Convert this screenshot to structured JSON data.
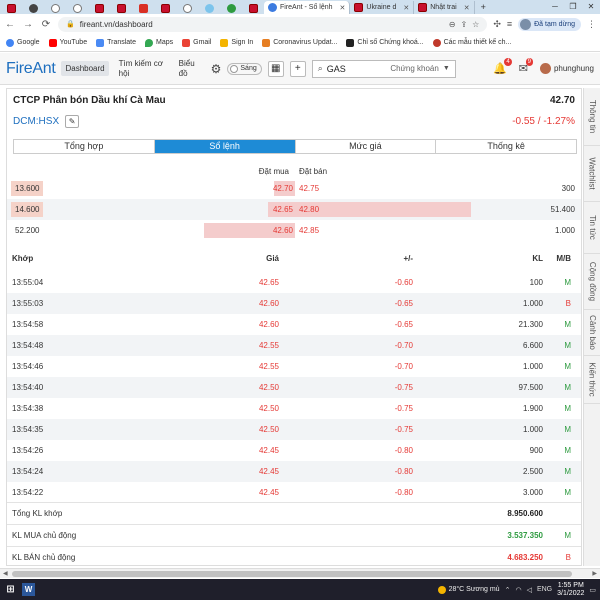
{
  "browser": {
    "tabs": [
      {
        "title": "FireAnt - Sổ lệnh",
        "active": true
      },
      {
        "title": "Ukraine d",
        "active": false
      },
      {
        "title": "Nhật trai",
        "active": false
      }
    ],
    "url": "fireant.vn/dashboard",
    "profile_label": "Đã tạm dừng",
    "bookmarks": [
      "Google",
      "YouTube",
      "Translate",
      "Maps",
      "Gmail",
      "Sign In",
      "Coronavirus Updat...",
      "Chỉ số Chứng khoá...",
      "Các mẫu thiết kế ch..."
    ]
  },
  "app": {
    "logo": "FireAnt",
    "nav": {
      "dashboard": "Dashboard",
      "search_opportunity": "Tìm kiếm cơ hội",
      "chart": "Biểu đồ"
    },
    "theme_label": "Sáng",
    "search": {
      "value": "GAS",
      "scope": "Chứng khoán"
    },
    "notification_count": "4",
    "message_count": "9",
    "username": "phunghung"
  },
  "stock": {
    "company_name": "CTCP Phân bón Dầu khí Cà Mau",
    "ticker": "DCM:HSX",
    "price": "42.70",
    "change": "-0.55 / -1.27%"
  },
  "tabs": [
    "Tổng hợp",
    "Sổ lệnh",
    "Mức giá",
    "Thống kê"
  ],
  "orderbook": {
    "bid_header": "Đặt mua",
    "ask_header": "Đặt bán",
    "rows": [
      {
        "bid_vol": "13.600",
        "bid_price": "42.70",
        "ask_price": "42.75",
        "ask_vol": "300",
        "bid_bar": 0.13,
        "ask_bar": 0.0
      },
      {
        "bid_vol": "14.600",
        "bid_price": "42.65",
        "ask_price": "42.80",
        "ask_vol": "51.400",
        "bid_bar": 0.17,
        "ask_bar": 1.0
      },
      {
        "bid_vol": "52.200",
        "bid_price": "42.60",
        "ask_price": "42.85",
        "ask_vol": "1.000",
        "bid_bar": 0.57,
        "ask_bar": 0.0
      }
    ]
  },
  "trades": {
    "headers": {
      "time": "Khớp",
      "price": "Giá",
      "change": "+/-",
      "volume": "KL",
      "side": "M/B"
    },
    "rows": [
      {
        "time": "13:55:04",
        "price": "42.65",
        "change": "-0.60",
        "volume": "100",
        "side": "M"
      },
      {
        "time": "13:55:03",
        "price": "42.60",
        "change": "-0.65",
        "volume": "1.000",
        "side": "B"
      },
      {
        "time": "13:54:58",
        "price": "42.60",
        "change": "-0.65",
        "volume": "21.300",
        "side": "M"
      },
      {
        "time": "13:54:48",
        "price": "42.55",
        "change": "-0.70",
        "volume": "6.600",
        "side": "M"
      },
      {
        "time": "13:54:46",
        "price": "42.55",
        "change": "-0.70",
        "volume": "1.000",
        "side": "M"
      },
      {
        "time": "13:54:40",
        "price": "42.50",
        "change": "-0.75",
        "volume": "97.500",
        "side": "M"
      },
      {
        "time": "13:54:38",
        "price": "42.50",
        "change": "-0.75",
        "volume": "1.900",
        "side": "M"
      },
      {
        "time": "13:54:35",
        "price": "42.50",
        "change": "-0.75",
        "volume": "1.000",
        "side": "M"
      },
      {
        "time": "13:54:26",
        "price": "42.45",
        "change": "-0.80",
        "volume": "900",
        "side": "M"
      },
      {
        "time": "13:54:24",
        "price": "42.45",
        "change": "-0.80",
        "volume": "2.500",
        "side": "M"
      },
      {
        "time": "13:54:22",
        "price": "42.45",
        "change": "-0.80",
        "volume": "3.000",
        "side": "M"
      }
    ]
  },
  "summary": {
    "total_label": "Tổng KL khớp",
    "total_value": "8.950.600",
    "buy_label": "KL MUA chủ động",
    "buy_value": "3.537.350",
    "buy_side": "M",
    "sell_label": "KL BÁN chủ động",
    "sell_value": "4.683.250",
    "sell_side": "B"
  },
  "sidebar": [
    "Thông tin",
    "Watchlist",
    "Tin tức",
    "Cộng đồng",
    "Cảnh báo",
    "Kiến thức"
  ],
  "taskbar": {
    "weather": "28°C  Sương mù",
    "lang": "ENG",
    "time": "1:55 PM",
    "date": "3/1/2022"
  },
  "colors": {
    "accent": "#1e8bd6",
    "down": "#e53935",
    "buy": "#2e9b40",
    "brand": "#1e6fbf"
  }
}
